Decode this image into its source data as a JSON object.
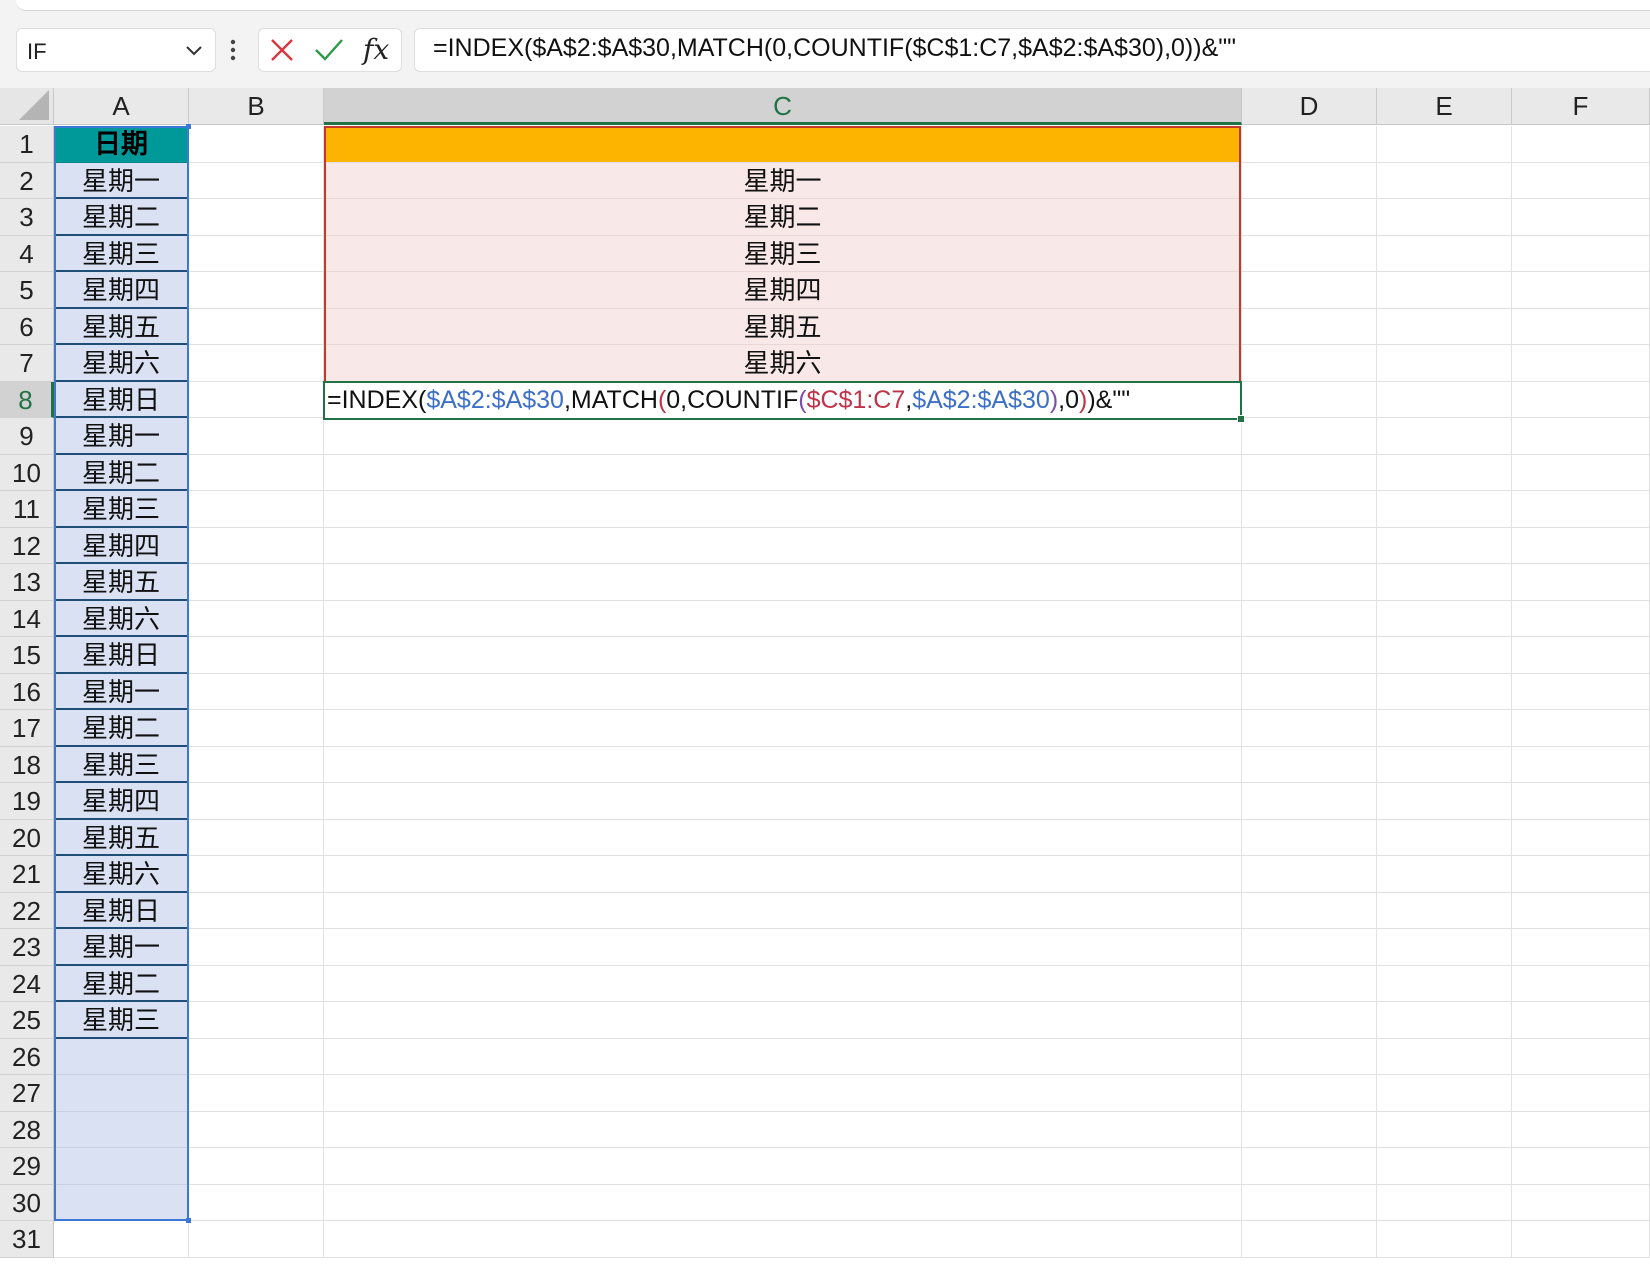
{
  "name_box": {
    "value": "IF"
  },
  "formula_bar": {
    "fx_label": "fx",
    "formula": "=INDEX($A$2:$A$30,MATCH(0,COUNTIF($C$1:C7,$A$2:$A$30),0))&\"\""
  },
  "columns": [
    "A",
    "B",
    "C",
    "D",
    "E",
    "F"
  ],
  "selected_column": "C",
  "rows": [
    "1",
    "2",
    "3",
    "4",
    "5",
    "6",
    "7",
    "8",
    "9",
    "10",
    "11",
    "12",
    "13",
    "14",
    "15",
    "16",
    "17",
    "18",
    "19",
    "20",
    "21",
    "22",
    "23",
    "24",
    "25",
    "26",
    "27",
    "28",
    "29",
    "30",
    "31"
  ],
  "selected_row": "8",
  "column_a": {
    "header": "日期",
    "values": [
      "星期一",
      "星期二",
      "星期三",
      "星期四",
      "星期五",
      "星期六",
      "星期日",
      "星期一",
      "星期二",
      "星期三",
      "星期四",
      "星期五",
      "星期六",
      "星期日",
      "星期一",
      "星期二",
      "星期三",
      "星期四",
      "星期五",
      "星期六",
      "星期日",
      "星期一",
      "星期二",
      "星期三"
    ]
  },
  "column_c": {
    "values": [
      "星期一",
      "星期二",
      "星期三",
      "星期四",
      "星期五",
      "星期六"
    ]
  },
  "active_cell_edit": {
    "parts": [
      {
        "text": "=INDEX(",
        "color": "default"
      },
      {
        "text": "$A$2:$A$30",
        "color": "blue"
      },
      {
        "text": ",MATCH",
        "color": "default"
      },
      {
        "text": "(",
        "color": "red"
      },
      {
        "text": "0,COUNTIF",
        "color": "default"
      },
      {
        "text": "(",
        "color": "purple"
      },
      {
        "text": "$C$1:C7",
        "color": "red"
      },
      {
        "text": ",",
        "color": "default"
      },
      {
        "text": "$A$2:$A$30",
        "color": "blue"
      },
      {
        "text": ")",
        "color": "purple"
      },
      {
        "text": ",0",
        "color": "default"
      },
      {
        "text": ")",
        "color": "red"
      },
      {
        "text": ")&\"\"",
        "color": "default"
      }
    ]
  },
  "colors": {
    "header_fill": "#009999",
    "c1_fill": "#FCB400",
    "c_range_fill": "#F8E8E8",
    "a_range_fill": "#D9E1F2",
    "excel_green": "#217346"
  }
}
